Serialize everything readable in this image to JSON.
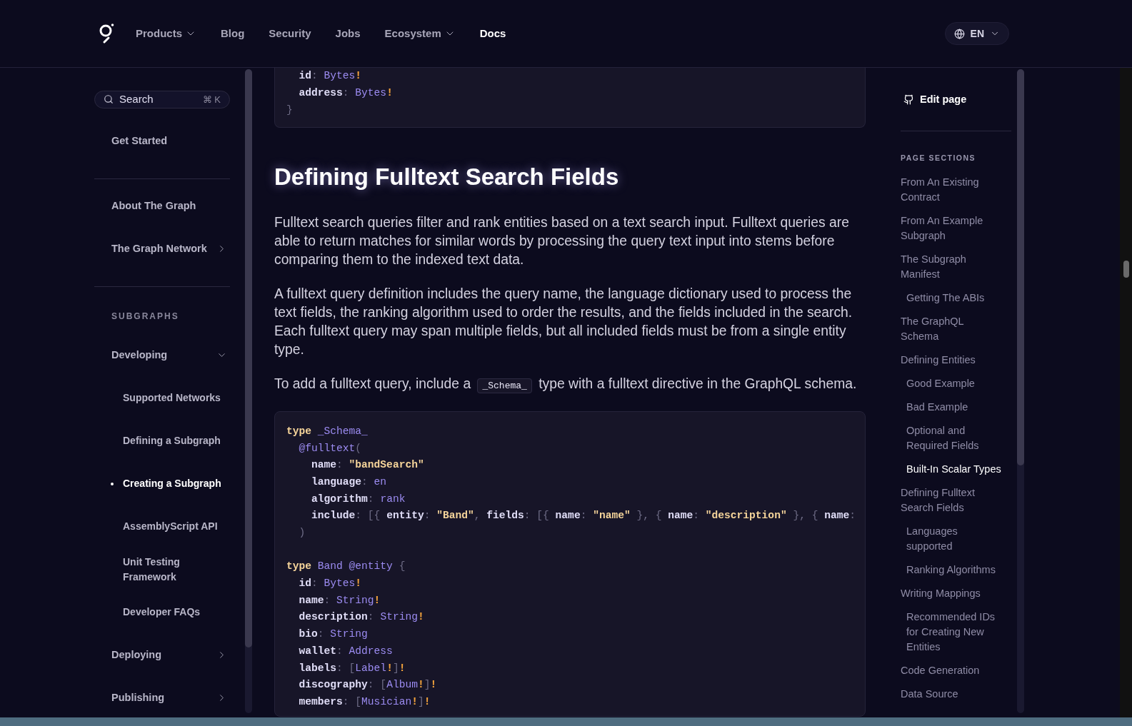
{
  "nav": {
    "items": [
      {
        "label": "Products",
        "has_menu": true,
        "selected": false
      },
      {
        "label": "Blog",
        "has_menu": false,
        "selected": false
      },
      {
        "label": "Security",
        "has_menu": false,
        "selected": false
      },
      {
        "label": "Jobs",
        "has_menu": false,
        "selected": false
      },
      {
        "label": "Ecosystem",
        "has_menu": true,
        "selected": false
      },
      {
        "label": "Docs",
        "has_menu": false,
        "selected": true
      }
    ],
    "language": "EN"
  },
  "sidebar": {
    "search": {
      "placeholder": "Search",
      "shortcut": "⌘ K"
    },
    "groups": [
      {
        "items": [
          {
            "label": "Get Started",
            "kind": "link",
            "selected": false
          }
        ]
      },
      {
        "items": [
          {
            "label": "About The Graph",
            "kind": "link",
            "selected": false
          },
          {
            "label": "The Graph Network",
            "kind": "collapsible",
            "expanded": false,
            "selected": false
          }
        ]
      },
      {
        "heading": "SUBGRAPHS",
        "items": [
          {
            "label": "Developing",
            "kind": "collapsible",
            "expanded": true,
            "selected": false,
            "children": [
              {
                "label": "Supported Networks",
                "selected": false
              },
              {
                "label": "Defining a Subgraph",
                "selected": false
              },
              {
                "label": "Creating a Subgraph",
                "selected": true
              },
              {
                "label": "AssemblyScript API",
                "selected": false
              },
              {
                "label": "Unit Testing Framework",
                "selected": false
              },
              {
                "label": "Developer FAQs",
                "selected": false
              }
            ]
          },
          {
            "label": "Deploying",
            "kind": "collapsible",
            "expanded": false,
            "selected": false
          },
          {
            "label": "Publishing",
            "kind": "collapsible",
            "expanded": false,
            "selected": false
          }
        ]
      }
    ]
  },
  "content": [
    {
      "kind": "code",
      "sections": [
        [
          [
            {
              "t": "  id",
              "kind": "key"
            },
            {
              "t": ": ",
              "kind": "punct"
            },
            {
              "t": "Bytes",
              "kind": "type"
            },
            {
              "t": "!",
              "kind": "bang"
            }
          ],
          [
            {
              "t": "  address",
              "kind": "key"
            },
            {
              "t": ": ",
              "kind": "punct"
            },
            {
              "t": "Bytes",
              "kind": "type"
            },
            {
              "t": "!",
              "kind": "bang"
            }
          ],
          [
            {
              "t": "}",
              "kind": "punct"
            }
          ]
        ]
      ]
    },
    {
      "kind": "heading",
      "text": "Defining Fulltext Search Fields"
    },
    {
      "kind": "paragraph",
      "text": "Fulltext search queries filter and rank entities based on a text search input. Fulltext queries are able to return matches for similar words by processing the query text input into stems before comparing them to the indexed text data."
    },
    {
      "kind": "paragraph",
      "text": "A fulltext query definition includes the query name, the language dictionary used to process the text fields, the ranking algorithm used to order the results, and the fields included in the search. Each fulltext query may span multiple fields, but all included fields must be from a single entity type."
    },
    {
      "kind": "paragraph",
      "text": "To add a fulltext query, include a ",
      "code": "_Schema_",
      "after": " type with a fulltext directive in the GraphQL schema."
    },
    {
      "kind": "code",
      "sections": [
        [
          [
            {
              "t": "type",
              "kind": "keyword"
            },
            {
              "t": " _Schema_",
              "kind": "type"
            }
          ],
          [
            {
              "t": "  @fulltext",
              "kind": "type"
            },
            {
              "t": "(",
              "kind": "punct"
            }
          ],
          [
            {
              "t": "    name",
              "kind": "key"
            },
            {
              "t": ": ",
              "kind": "punct"
            },
            {
              "t": "\"bandSearch\"",
              "kind": "string"
            }
          ],
          [
            {
              "t": "    language",
              "kind": "key"
            },
            {
              "t": ": ",
              "kind": "punct"
            },
            {
              "t": "en",
              "kind": "type"
            }
          ],
          [
            {
              "t": "    algorithm",
              "kind": "key"
            },
            {
              "t": ": ",
              "kind": "punct"
            },
            {
              "t": "rank",
              "kind": "type"
            }
          ],
          [
            {
              "t": "    include",
              "kind": "key"
            },
            {
              "t": ": [{ ",
              "kind": "punct"
            },
            {
              "t": "entity",
              "kind": "key"
            },
            {
              "t": ": ",
              "kind": "punct"
            },
            {
              "t": "\"Band\"",
              "kind": "string"
            },
            {
              "t": ", ",
              "kind": "punct"
            },
            {
              "t": "fields",
              "kind": "key"
            },
            {
              "t": ": [{ ",
              "kind": "punct"
            },
            {
              "t": "name",
              "kind": "key"
            },
            {
              "t": ": ",
              "kind": "punct"
            },
            {
              "t": "\"name\"",
              "kind": "string"
            },
            {
              "t": " }, { ",
              "kind": "punct"
            },
            {
              "t": "name",
              "kind": "key"
            },
            {
              "t": ": ",
              "kind": "punct"
            },
            {
              "t": "\"description\"",
              "kind": "string"
            },
            {
              "t": " }, { ",
              "kind": "punct"
            },
            {
              "t": "name",
              "kind": "key"
            },
            {
              "t": ":",
              "kind": "punct"
            }
          ],
          [
            {
              "t": "  )",
              "kind": "punct"
            }
          ]
        ],
        [
          [
            {
              "t": "type",
              "kind": "keyword"
            },
            {
              "t": " Band @entity",
              "kind": "type"
            },
            {
              "t": " {",
              "kind": "punct"
            }
          ],
          [
            {
              "t": "  id",
              "kind": "key"
            },
            {
              "t": ": ",
              "kind": "punct"
            },
            {
              "t": "Bytes",
              "kind": "type"
            },
            {
              "t": "!",
              "kind": "bang"
            }
          ],
          [
            {
              "t": "  name",
              "kind": "key"
            },
            {
              "t": ": ",
              "kind": "punct"
            },
            {
              "t": "String",
              "kind": "type"
            },
            {
              "t": "!",
              "kind": "bang"
            }
          ],
          [
            {
              "t": "  description",
              "kind": "key"
            },
            {
              "t": ": ",
              "kind": "punct"
            },
            {
              "t": "String",
              "kind": "type"
            },
            {
              "t": "!",
              "kind": "bang"
            }
          ],
          [
            {
              "t": "  bio",
              "kind": "key"
            },
            {
              "t": ": ",
              "kind": "punct"
            },
            {
              "t": "String",
              "kind": "type"
            }
          ],
          [
            {
              "t": "  wallet",
              "kind": "key"
            },
            {
              "t": ": ",
              "kind": "punct"
            },
            {
              "t": "Address",
              "kind": "type"
            }
          ],
          [
            {
              "t": "  labels",
              "kind": "key"
            },
            {
              "t": ": [",
              "kind": "punct"
            },
            {
              "t": "Label",
              "kind": "type"
            },
            {
              "t": "!",
              "kind": "bang"
            },
            {
              "t": "]",
              "kind": "punct"
            },
            {
              "t": "!",
              "kind": "bang"
            }
          ],
          [
            {
              "t": "  discography",
              "kind": "key"
            },
            {
              "t": ": [",
              "kind": "punct"
            },
            {
              "t": "Album",
              "kind": "type"
            },
            {
              "t": "!",
              "kind": "bang"
            },
            {
              "t": "]",
              "kind": "punct"
            },
            {
              "t": "!",
              "kind": "bang"
            }
          ],
          [
            {
              "t": "  members",
              "kind": "key"
            },
            {
              "t": ": [",
              "kind": "punct"
            },
            {
              "t": "Musician",
              "kind": "type"
            },
            {
              "t": "!",
              "kind": "bang"
            },
            {
              "t": "]",
              "kind": "punct"
            },
            {
              "t": "!",
              "kind": "bang"
            }
          ]
        ]
      ]
    }
  ],
  "toc": {
    "edit": "Edit page",
    "heading": "PAGE SECTIONS",
    "items": [
      {
        "label": "From An Existing Contract",
        "selected": false
      },
      {
        "label": "From An Example Subgraph",
        "selected": false
      },
      {
        "label": "The Subgraph Manifest",
        "selected": false,
        "children": [
          {
            "label": "Getting The ABIs",
            "selected": false
          }
        ]
      },
      {
        "label": "The GraphQL Schema",
        "selected": false
      },
      {
        "label": "Defining Entities",
        "selected": false,
        "children": [
          {
            "label": "Good Example",
            "selected": false
          },
          {
            "label": "Bad Example",
            "selected": false
          },
          {
            "label": "Optional and Required Fields",
            "selected": false
          },
          {
            "label": "Built-In Scalar Types",
            "selected": true
          }
        ]
      },
      {
        "label": "Defining Fulltext Search Fields",
        "selected": false,
        "children": [
          {
            "label": "Languages supported",
            "selected": false
          },
          {
            "label": "Ranking Algorithms",
            "selected": false
          }
        ]
      },
      {
        "label": "Writing Mappings",
        "selected": false,
        "children": [
          {
            "label": "Recommended IDs for Creating New Entities",
            "selected": false
          }
        ]
      },
      {
        "label": "Code Generation",
        "selected": false
      },
      {
        "label": "Data Source",
        "selected": false
      }
    ]
  }
}
